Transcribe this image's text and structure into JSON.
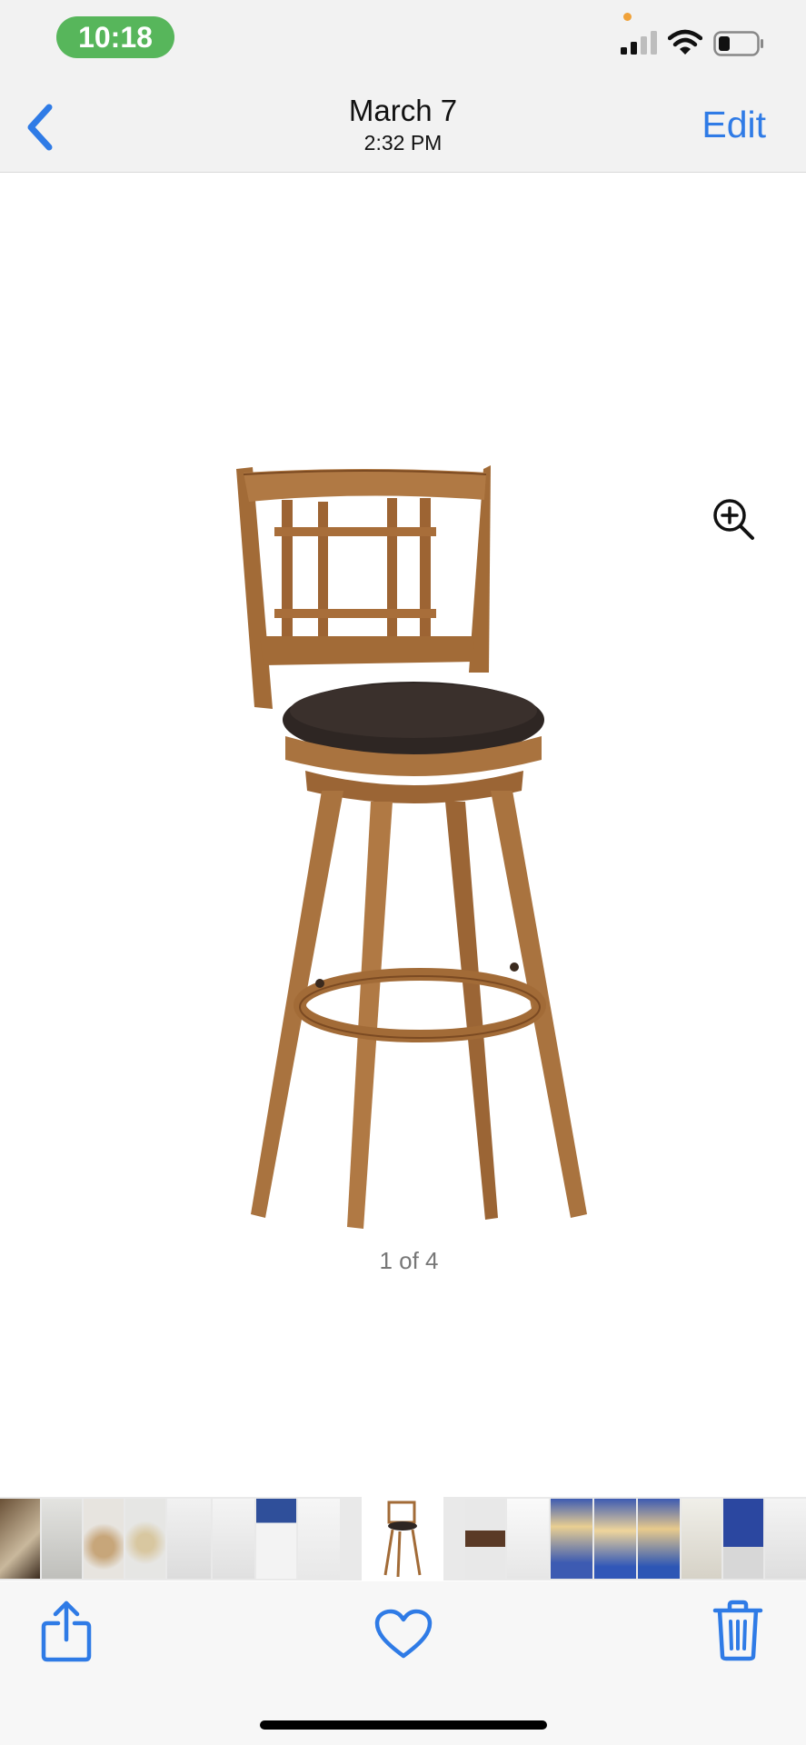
{
  "status_bar": {
    "time": "10:18"
  },
  "nav": {
    "date": "March 7",
    "time": "2:32 PM",
    "edit_label": "Edit"
  },
  "photo": {
    "subject": "wooden swivel bar stool with dark leather seat",
    "counter": "1 of 4"
  },
  "icons": {
    "back": "chevron-left-icon",
    "zoom": "zoom-in-icon",
    "share": "share-icon",
    "favorite": "heart-icon",
    "delete": "trash-icon"
  },
  "colors": {
    "accent": "#2f7be6",
    "time_pill": "#57b65b",
    "wood": "#a9733f",
    "seat": "#2e2623"
  }
}
